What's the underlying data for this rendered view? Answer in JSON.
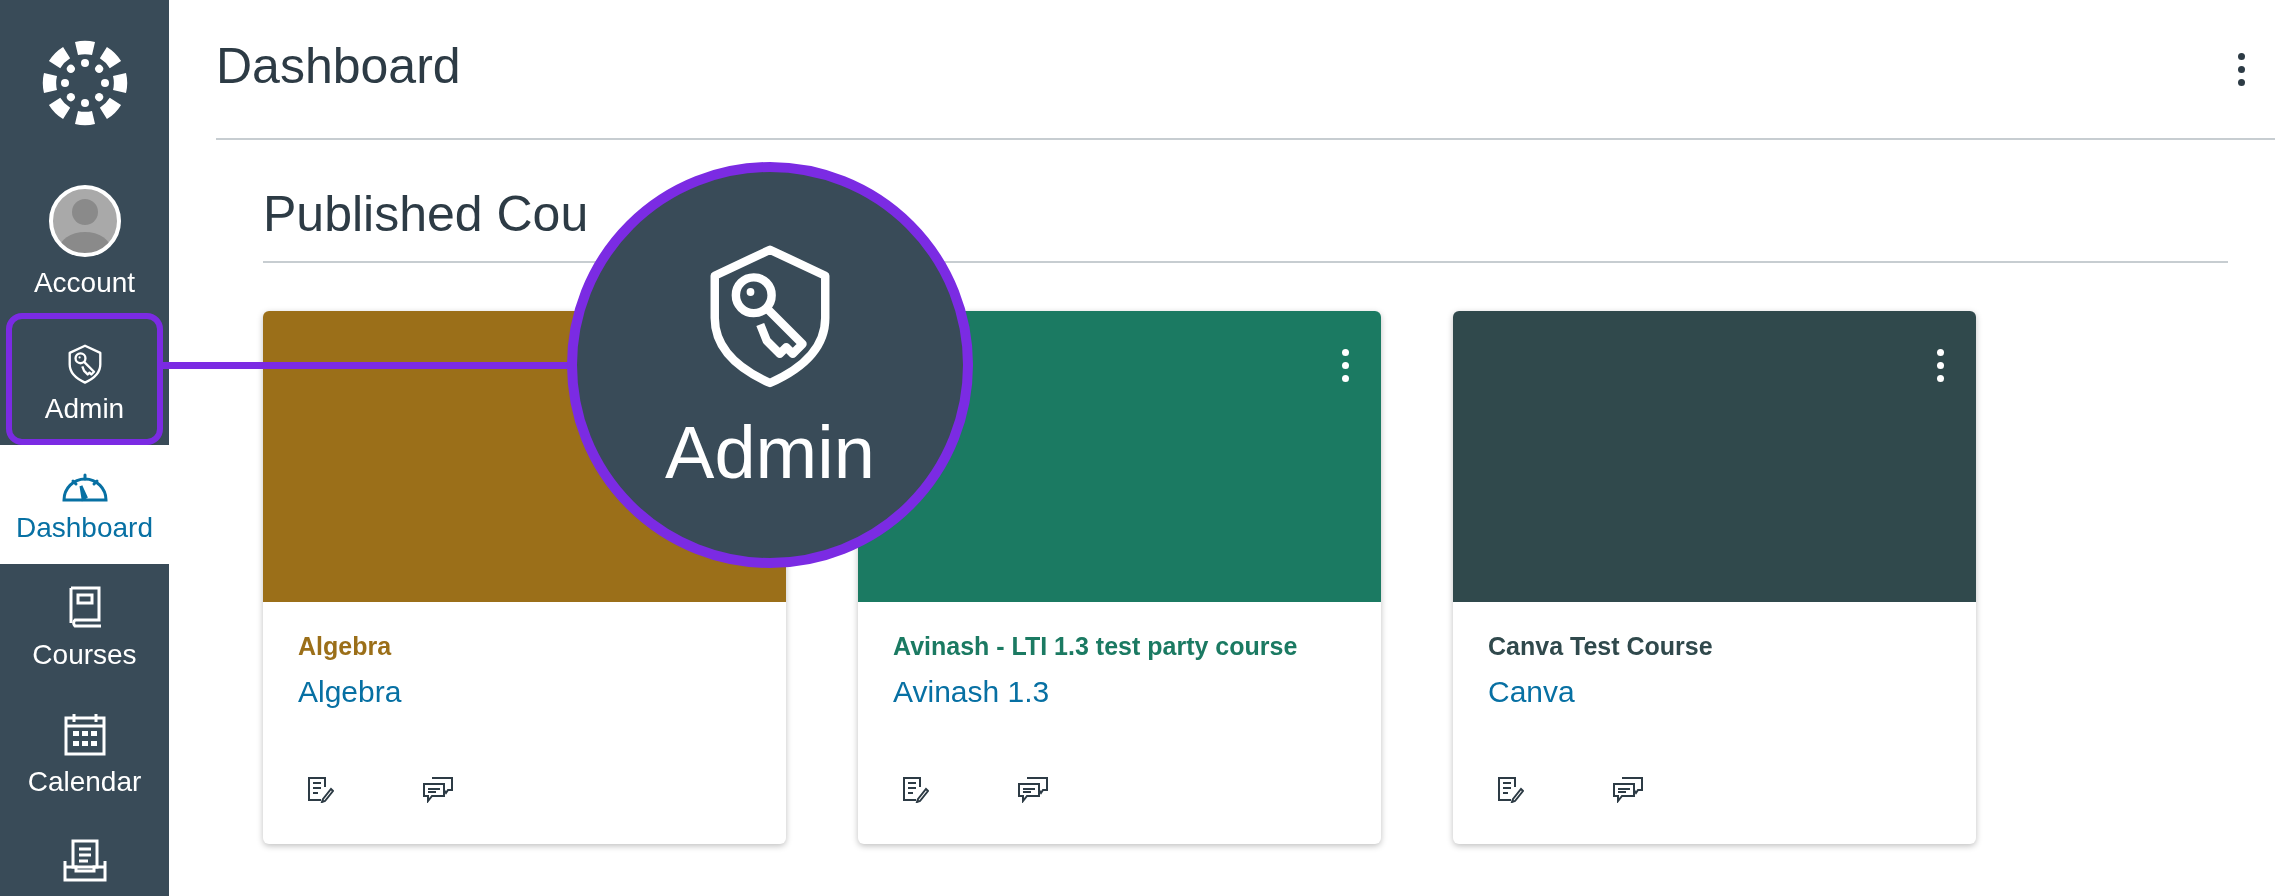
{
  "sidebar": {
    "items": [
      {
        "kind": "account",
        "label": "Account",
        "selected": false,
        "highlighted": false
      },
      {
        "kind": "admin",
        "label": "Admin",
        "selected": false,
        "highlighted": true
      },
      {
        "kind": "dashboard",
        "label": "Dashboard",
        "selected": true,
        "highlighted": false
      },
      {
        "kind": "courses",
        "label": "Courses",
        "selected": false,
        "highlighted": false
      },
      {
        "kind": "calendar",
        "label": "Calendar",
        "selected": false,
        "highlighted": false
      },
      {
        "kind": "inbox",
        "selected": false,
        "highlighted": false
      }
    ]
  },
  "header": {
    "title": "Dashboard"
  },
  "section": {
    "title": "Published Cou"
  },
  "cards": [
    {
      "code": "Algebra",
      "name": "Algebra",
      "color": "#9b6f19"
    },
    {
      "code": "Avinash - LTI 1.3 test party course",
      "name": "Avinash 1.3",
      "color": "#1b7a62",
      "has_menu": true
    },
    {
      "code": "Canva Test Course",
      "name": "Canva",
      "color": "#30494c",
      "has_menu": true
    }
  ],
  "callout": {
    "label": "Admin"
  }
}
